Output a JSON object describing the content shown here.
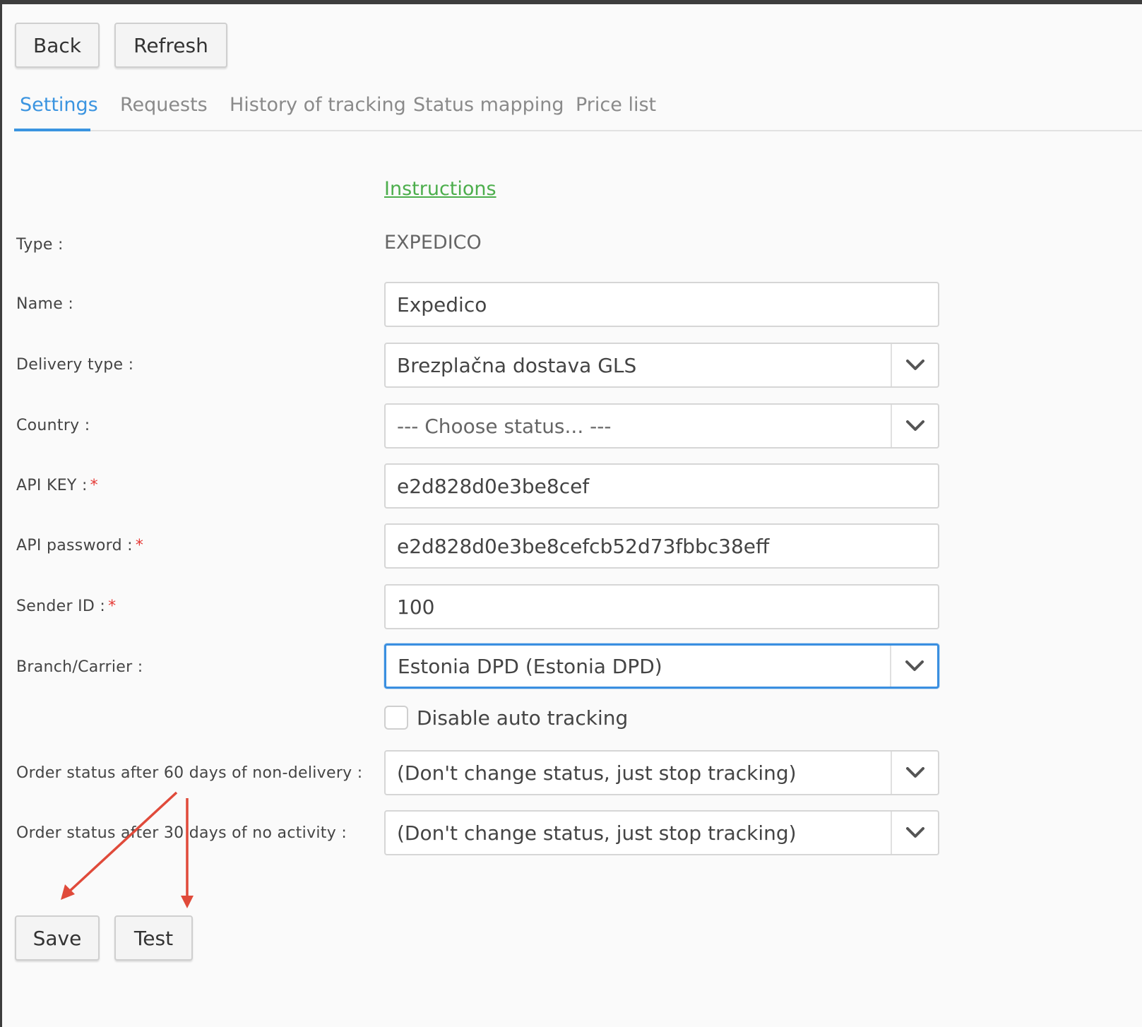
{
  "toolbar": {
    "back_label": "Back",
    "refresh_label": "Refresh"
  },
  "tabs": [
    {
      "label": "Settings",
      "active": true
    },
    {
      "label": "Requests",
      "active": false
    },
    {
      "label": "History of tracking",
      "active": false
    },
    {
      "label": "Status mapping",
      "active": false
    },
    {
      "label": "Price list",
      "active": false
    }
  ],
  "instructions_link": "Instructions",
  "form": {
    "type": {
      "label": "Type :",
      "value": "EXPEDICO"
    },
    "name": {
      "label": "Name :",
      "value": "Expedico"
    },
    "delivery_type": {
      "label": "Delivery type :",
      "value": "Brezplačna dostava GLS"
    },
    "country": {
      "label": "Country :",
      "placeholder": "--- Choose status... ---"
    },
    "api_key": {
      "label": "API KEY :",
      "required_mark": "*",
      "value": "e2d828d0e3be8cef"
    },
    "api_password": {
      "label": "API password :",
      "required_mark": "*",
      "value": "e2d828d0e3be8cefcb52d73fbbc38eff"
    },
    "sender_id": {
      "label": "Sender ID :",
      "required_mark": "*",
      "value": "100"
    },
    "branch_carrier": {
      "label": "Branch/Carrier :",
      "value": "Estonia DPD (Estonia DPD)"
    },
    "disable_auto_tracking": {
      "label": "Disable auto tracking",
      "checked": false
    },
    "status_after_60": {
      "label": "Order status after 60 days of non-delivery :",
      "value": "(Don't change status, just stop tracking)"
    },
    "status_after_30": {
      "label": "Order status after 30 days of no activity :",
      "value": "(Don't change status, just stop tracking)"
    }
  },
  "footer": {
    "save_label": "Save",
    "test_label": "Test"
  },
  "colors": {
    "accent": "#3a94e0",
    "link": "#4cae4c",
    "required": "#e53935",
    "annotation_arrow": "#e04a3a"
  },
  "icons": {
    "select_caret": "chevron-down-icon"
  }
}
